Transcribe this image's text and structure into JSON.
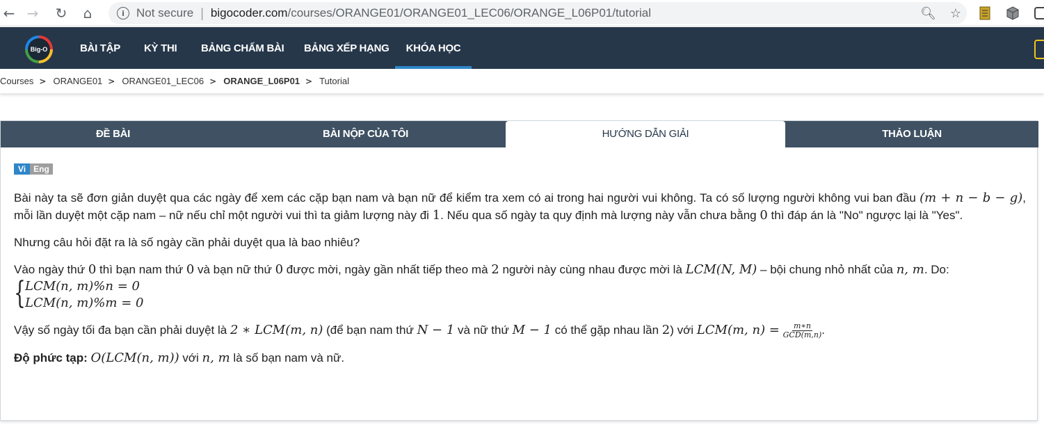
{
  "browser": {
    "secure_label": "Not secure",
    "url_host": "bigocoder.com",
    "url_path": "/courses/ORANGE01/ORANGE01_LEC06/ORANGE_L06P01/tutorial"
  },
  "site": {
    "logo_text": "Big-O",
    "nav": [
      "BÀI TẬP",
      "KỲ THI",
      "BẢNG CHẤM BÀI",
      "BẢNG XẾP HẠNG",
      "KHÓA HỌC"
    ],
    "active_nav": "KHÓA HỌC"
  },
  "breadcrumb": [
    "Courses",
    "ORANGE01",
    "ORANGE01_LEC06",
    "ORANGE_L06P01",
    "Tutorial"
  ],
  "tabs": [
    "ĐỀ BÀI",
    "BÀI NỘP CỦA TÔI",
    "HƯỚNG DẪN GIẢI",
    "THẢO LUẬN"
  ],
  "active_tab": "HƯỚNG DẪN GIẢI",
  "lang": {
    "vi": "Vi",
    "en": "Eng"
  },
  "content": {
    "p1a": "Bài này ta sẽ đơn giản duyệt qua các ngày để xem các cặp bạn nam và bạn nữ để kiểm tra xem có ai trong hai người vui không. Ta có số lượng người không vui ban đầu ",
    "p1_math1": "(m + n − b − g)",
    "p1b": ", mỗi lần duyệt một cặp nam – nữ nếu chỉ một người vui thì ta giảm lượng này đi ",
    "p1_one": "1",
    "p1c": ". Nếu qua số ngày ta quy định mà lượng này vẫn chưa bằng ",
    "p1_zero": "0",
    "p1d": " thì đáp án là \"No\" ngược lại là \"Yes\".",
    "p2": "Nhưng câu hỏi đặt ra là số ngày cần phải duyệt qua là bao nhiêu?",
    "p3a": "Vào ngày thứ ",
    "p3_z1": "0",
    "p3b": " thì bạn nam thứ ",
    "p3_z2": "0",
    "p3c": " và bạn nữ thứ ",
    "p3_z3": "0",
    "p3d": " được mời, ngày gần nhất tiếp theo mà ",
    "p3_two": "2",
    "p3e": " người này cùng nhau được mời là ",
    "p3_lcm": "LCM(N, M)",
    "p3f": " – bội chung nhỏ nhất của ",
    "p3_nm": "n, m",
    "p3g": ". Do:",
    "case1": "LCM(n, m)%n = 0",
    "case2": "LCM(n, m)%m = 0",
    "p4a": "Vậy số ngày tối đa bạn cần phải duyệt là ",
    "p4_m1": "2 ∗ LCM(m, n)",
    "p4b": " (để bạn nam thứ ",
    "p4_m2": "N − 1",
    "p4c": " và nữ thứ ",
    "p4_m3": "M − 1",
    "p4d": " có thể gặp nhau lần ",
    "p4_two": "2",
    "p4e": ") với ",
    "p4_m4": "LCM(m, n) =",
    "frac_num": "m∗n",
    "frac_den": "GCD(m,n)",
    "p4f": ".",
    "p5_label": "Độ phức tạp:",
    "p5_m1": "O(LCM(n, m))",
    "p5b": " với ",
    "p5_m2": "n, m",
    "p5c": " là số bạn nam và nữ."
  }
}
